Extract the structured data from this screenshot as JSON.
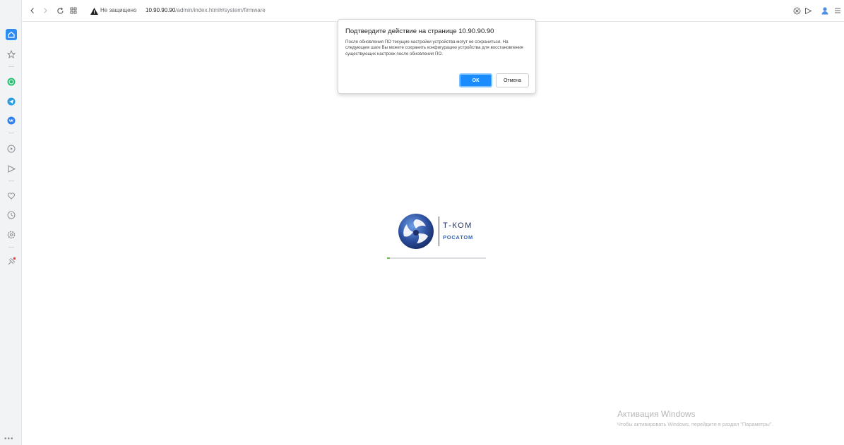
{
  "browser": {
    "security_label": "Не защищено",
    "url_host": "10.90.90.90",
    "url_path": "/admin/index.html#/system/firmware"
  },
  "sidebar": {
    "items": [
      {
        "name": "home-icon",
        "color": "#2f8cf2"
      },
      {
        "name": "star-icon",
        "color": "#8a8d93"
      },
      {
        "name": "whatsapp-icon",
        "color": "#25c16f"
      },
      {
        "name": "telegram-icon",
        "color": "#2a9de0"
      },
      {
        "name": "vk-icon",
        "color": "#2f7ff0"
      },
      {
        "name": "play-icon",
        "color": "#8a8d93"
      },
      {
        "name": "send-icon",
        "color": "#8a8d93"
      },
      {
        "name": "heart-icon",
        "color": "#8a8d93"
      },
      {
        "name": "clock-icon",
        "color": "#8a8d93"
      },
      {
        "name": "settings-icon",
        "color": "#8a8d93"
      },
      {
        "name": "pin-icon",
        "color": "#8a8d93"
      }
    ],
    "more_label": "•••"
  },
  "dialog": {
    "title": "Подтвердите действие на странице 10.90.90.90",
    "message": "После обновления ПО текущие настройки устройства могут не сохраниться. На следующем шаге Вы можете сохранить конфигурацию устройства для восстановления существующих настроек после обновления ПО.",
    "ok_label": "ОК",
    "cancel_label": "Отмена"
  },
  "loader": {
    "brand_line1": "Т-КОМ",
    "brand_line2": "РОСАТОМ",
    "progress": 0.03
  },
  "watermark": {
    "title": "Активация Windows",
    "subtitle": "Чтобы активировать Windows, перейдите в раздел \"Параметры\"."
  },
  "colors": {
    "accent": "#1a8cff",
    "progress": "#6cc04a",
    "brand_dark": "#1d2f66"
  }
}
